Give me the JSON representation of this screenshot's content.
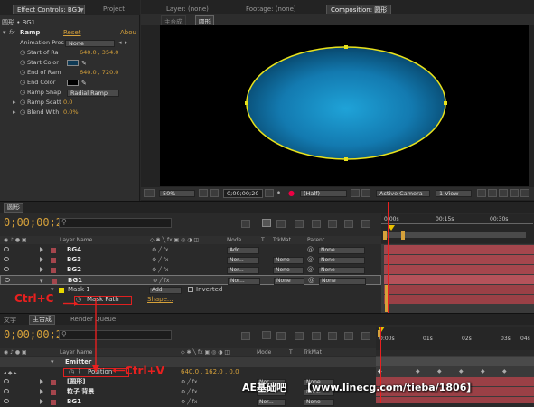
{
  "effect_panel": {
    "tabs": [
      "Effect Controls: BG1",
      "Project"
    ],
    "breadcrumb": "圆形 • BG1",
    "effect": {
      "name": "Ramp",
      "reset": "Reset",
      "about": "Abou"
    },
    "props": [
      {
        "label": "Animation Pres",
        "value": "None",
        "type": "dropdown"
      },
      {
        "label": "Start of Ra",
        "value": "640.0 , 354.0",
        "type": "value"
      },
      {
        "label": "Start Color",
        "value": "",
        "type": "color",
        "color": "#0f3a55"
      },
      {
        "label": "End of Ram",
        "value": "640.0 , 720.0",
        "type": "value"
      },
      {
        "label": "End Color",
        "value": "",
        "type": "color",
        "color": "#000000"
      },
      {
        "label": "Ramp Shap",
        "value": "Radial Ramp",
        "type": "dropdown"
      },
      {
        "label": "Ramp Scatt",
        "value": "0.0",
        "type": "value"
      },
      {
        "label": "Blend With",
        "value": "0.0%",
        "type": "value"
      }
    ]
  },
  "viewer": {
    "tabs": [
      "Layer: (none)",
      "Footage: (none)",
      "Composition: 圆形"
    ],
    "comp_tabs": [
      "主合成",
      "圆形"
    ],
    "zoom": "50%",
    "timecode": "0;00;00;20",
    "resolution": "(Half)",
    "camera": "Active Camera",
    "view": "1 View",
    "ellipse_fill": "#1a8fc4",
    "ellipse_stroke": "#e8e21c"
  },
  "timeline1": {
    "tab": "圆形",
    "timecode": "0;00;00;20",
    "search_placeholder": "",
    "col_layer_name": "Layer Name",
    "col_mode": "Mode",
    "col_t": "T",
    "col_trkmat": "TrkMat",
    "col_parent": "Parent",
    "ruler": [
      "0:00s",
      "00:15s",
      "00:30s"
    ],
    "layers": [
      {
        "num": "",
        "name": "BG4",
        "mode": "Add",
        "trkmat": "",
        "parent": "None",
        "color": "#a5464d"
      },
      {
        "num": "",
        "name": "BG3",
        "mode": "Nor...",
        "trkmat": "None",
        "parent": "None",
        "color": "#a5464d"
      },
      {
        "num": "",
        "name": "BG2",
        "mode": "Nor...",
        "trkmat": "None",
        "parent": "None",
        "color": "#a5464d"
      },
      {
        "num": "",
        "name": "BG1",
        "mode": "Nor...",
        "trkmat": "None",
        "parent": "None",
        "color": "#a5464d"
      }
    ],
    "mask_name": "Mask 1",
    "mask_mode": "Add",
    "mask_inverted": "Inverted",
    "mask_path": "Mask Path",
    "mask_shape": "Shape..."
  },
  "timeline2": {
    "tabs": [
      "文字",
      "主合成",
      "Render Queue"
    ],
    "timecode": "0;00;00;20",
    "col_layer_name": "Layer Name",
    "col_mode": "Mode",
    "col_t": "T",
    "col_trkmat": "TrkMat",
    "ruler": [
      "0:00s",
      "01s",
      "02s",
      "03s",
      "04s"
    ],
    "emitter": "Emitter",
    "position_label": "Position",
    "position_value": "640.0 , 162.0 , 0.0",
    "layers": [
      {
        "name": "[圆形]",
        "mode": "Nor...",
        "trkmat": "None"
      },
      {
        "name": "粒子 背景",
        "mode": "Nor...",
        "trkmat": "None"
      },
      {
        "name": "BG1",
        "mode": "Nor...",
        "trkmat": "None"
      }
    ]
  },
  "annotations": {
    "ctrl_c": "Ctrl+C",
    "ctrl_v": "Ctrl+V",
    "watermark_prefix": "AE基础吧",
    "watermark_url": "【www.linecg.com/tieba/1806】"
  }
}
